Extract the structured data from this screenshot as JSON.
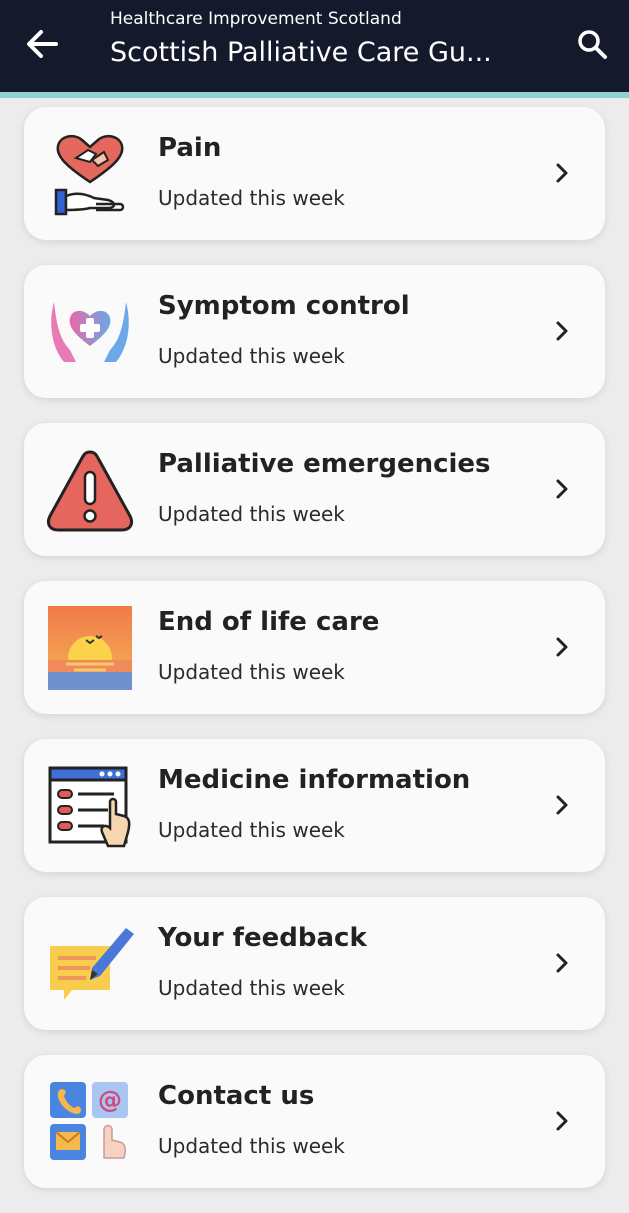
{
  "header": {
    "subtitle": "Healthcare Improvement Scotland",
    "title": "Scottish Palliative Care Gu...",
    "back_icon": "arrow-left-icon",
    "search_icon": "search-icon"
  },
  "colors": {
    "appbar": "#141a2b",
    "accent_line": "#8fd0d2",
    "card": "#fafafa",
    "background": "#ececec"
  },
  "items": [
    {
      "label": "Pain",
      "status": "Updated this week",
      "icon": "heart-hands-icon"
    },
    {
      "label": "Symptom control",
      "status": "Updated this week",
      "icon": "care-hands-icon"
    },
    {
      "label": "Palliative emergencies",
      "status": "Updated this week",
      "icon": "warning-icon"
    },
    {
      "label": "End of life care",
      "status": "Updated this week",
      "icon": "sunset-icon"
    },
    {
      "label": "Medicine information",
      "status": "Updated this week",
      "icon": "checklist-icon"
    },
    {
      "label": "Your feedback",
      "status": "Updated this week",
      "icon": "feedback-icon"
    },
    {
      "label": "Contact us",
      "status": "Updated this week",
      "icon": "contact-icon"
    }
  ]
}
